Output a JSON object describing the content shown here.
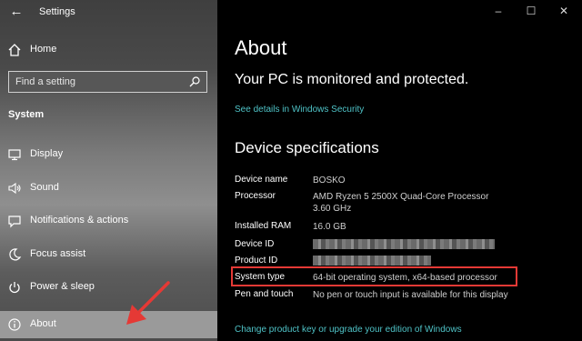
{
  "window": {
    "title": "Settings"
  },
  "sidebar": {
    "home_label": "Home",
    "search": {
      "placeholder": "Find a setting"
    },
    "section_label": "System",
    "items": [
      {
        "label": "Display",
        "icon": "display-icon"
      },
      {
        "label": "Sound",
        "icon": "speaker-icon"
      },
      {
        "label": "Notifications & actions",
        "icon": "notification-icon"
      },
      {
        "label": "Focus assist",
        "icon": "moon-icon"
      },
      {
        "label": "Power & sleep",
        "icon": "power-icon"
      },
      {
        "label": "About",
        "icon": "info-icon",
        "selected": true
      }
    ]
  },
  "main": {
    "title": "About",
    "status_title": "Your PC is monitored and protected.",
    "security_link": "See details in Windows Security",
    "specs_heading": "Device specifications",
    "specs": [
      {
        "key": "Device name",
        "value": "BOSKO"
      },
      {
        "key": "Processor",
        "value": "AMD Ryzen 5 2500X Quad-Core Processor",
        "value2": "3.60 GHz"
      },
      {
        "key": "Installed RAM",
        "value": "16.0 GB"
      },
      {
        "key": "Device ID",
        "value": ""
      },
      {
        "key": "Product ID",
        "value": ""
      },
      {
        "key": "System type",
        "value": "64-bit operating system, x64-based processor"
      },
      {
        "key": "Pen and touch",
        "value": "No pen or touch input is available for this display"
      }
    ],
    "product_key_link": "Change product key or upgrade your edition of Windows"
  },
  "colors": {
    "link": "#4fc3c7",
    "highlight": "#e53935",
    "annotation_arrow": "#e53935"
  }
}
